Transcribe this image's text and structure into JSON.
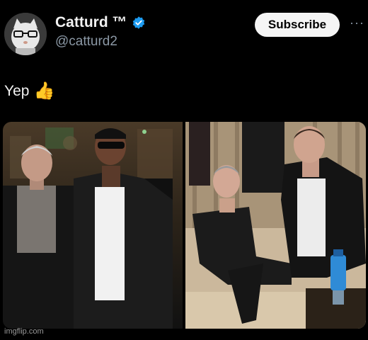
{
  "author": {
    "name": "Catturd ™",
    "handle": "@catturd2",
    "verified": true,
    "verified_color": "#1d9bf0"
  },
  "actions": {
    "subscribe_label": "Subscribe",
    "more_label": "···"
  },
  "tweet": {
    "text": "Yep",
    "emoji": "👍"
  },
  "media": {
    "images": [
      {
        "icon": "photo-two-men-standing"
      },
      {
        "icon": "photo-two-men-on-couch"
      }
    ]
  },
  "watermark": "imgflip.com"
}
